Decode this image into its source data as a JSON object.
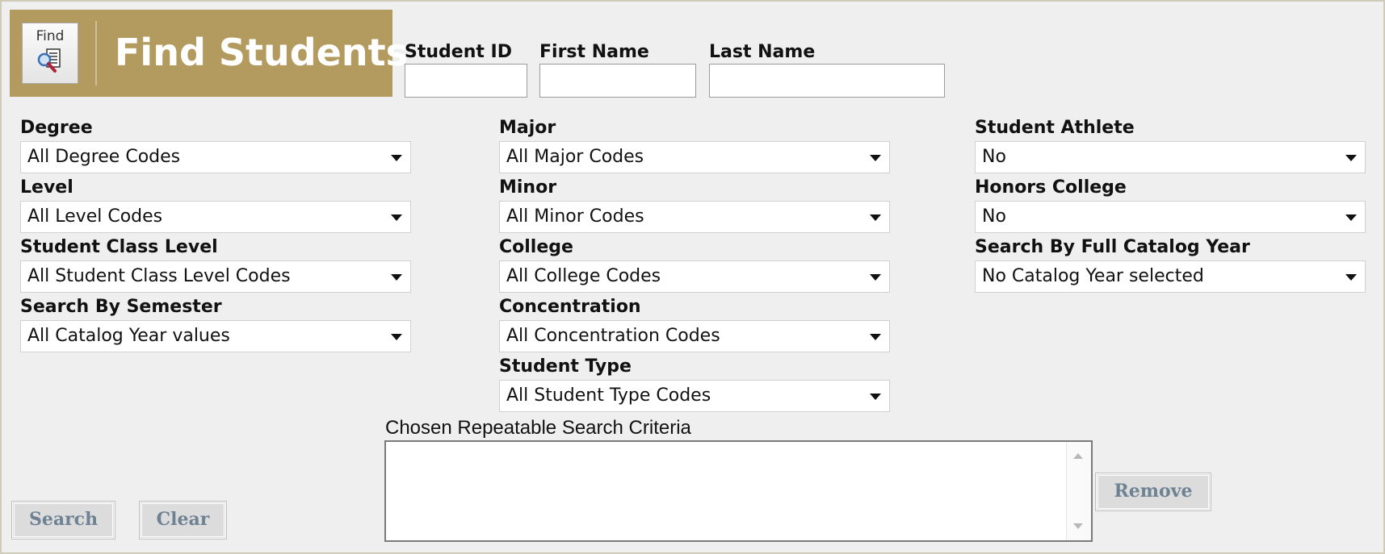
{
  "header": {
    "icon_text": "Find",
    "title": "Find Students"
  },
  "id_fields": {
    "student_id_label": "Student ID",
    "first_name_label": "First Name",
    "last_name_label": "Last Name",
    "student_id_value": "",
    "first_name_value": "",
    "last_name_value": ""
  },
  "filters": {
    "degree": {
      "label": "Degree",
      "value": "All Degree Codes"
    },
    "level": {
      "label": "Level",
      "value": "All Level Codes"
    },
    "student_class_level": {
      "label": "Student Class Level",
      "value": "All Student Class Level Codes"
    },
    "search_by_semester": {
      "label": "Search By Semester",
      "value": "All Catalog Year values"
    },
    "major": {
      "label": "Major",
      "value": "All Major Codes"
    },
    "minor": {
      "label": "Minor",
      "value": "All Minor Codes"
    },
    "college": {
      "label": "College",
      "value": "All College Codes"
    },
    "concentration": {
      "label": "Concentration",
      "value": "All Concentration Codes"
    },
    "student_type": {
      "label": "Student Type",
      "value": "All Student Type Codes"
    },
    "student_athlete": {
      "label": "Student Athlete",
      "value": "No"
    },
    "honors_college": {
      "label": "Honors College",
      "value": "No"
    },
    "full_catalog_year": {
      "label": "Search By Full Catalog Year",
      "value": "No Catalog Year selected"
    }
  },
  "criteria": {
    "label": "Chosen Repeatable Search Criteria",
    "items": []
  },
  "buttons": {
    "remove": "Remove",
    "search": "Search",
    "clear": "Clear"
  },
  "colors": {
    "banner": "#b39b5f",
    "button_text": "#6f8293",
    "page_background": "#efefef"
  }
}
